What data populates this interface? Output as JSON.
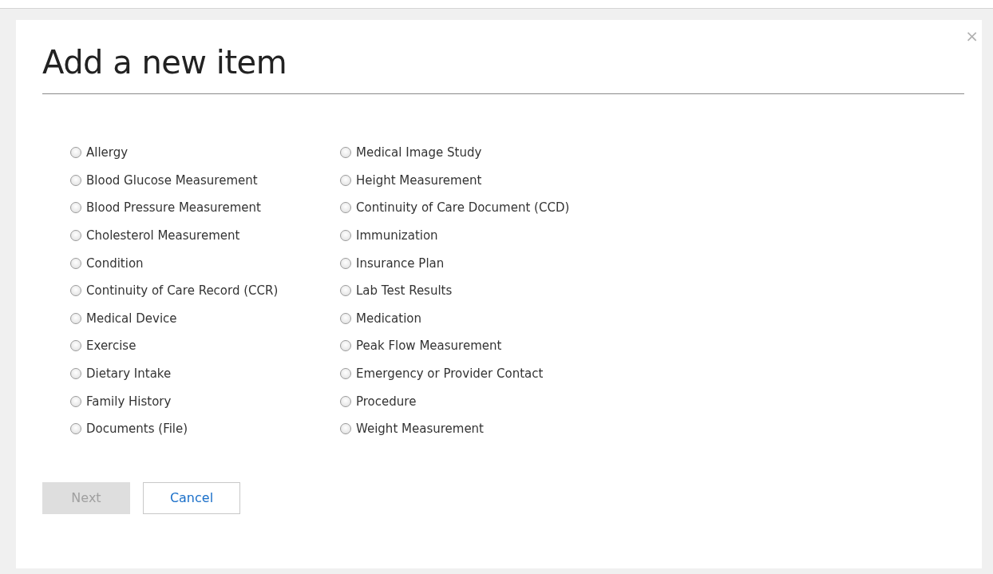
{
  "dialog": {
    "title": "Add a new item",
    "close": "×",
    "options": [
      {
        "label": "Allergy",
        "selected": false
      },
      {
        "label": "Blood Glucose Measurement",
        "selected": false
      },
      {
        "label": "Blood Pressure Measurement",
        "selected": false
      },
      {
        "label": "Cholesterol Measurement",
        "selected": false
      },
      {
        "label": "Condition",
        "selected": false
      },
      {
        "label": "Continuity of Care Record (CCR)",
        "selected": false
      },
      {
        "label": "Medical Device",
        "selected": false
      },
      {
        "label": "Exercise",
        "selected": false
      },
      {
        "label": "Dietary Intake",
        "selected": false
      },
      {
        "label": "Family History",
        "selected": false
      },
      {
        "label": "Documents (File)",
        "selected": false
      },
      {
        "label": "Medical Image Study",
        "selected": false
      },
      {
        "label": "Height Measurement",
        "selected": false
      },
      {
        "label": "Continuity of Care Document (CCD)",
        "selected": false
      },
      {
        "label": "Immunization",
        "selected": false
      },
      {
        "label": "Insurance Plan",
        "selected": false
      },
      {
        "label": "Lab Test Results",
        "selected": false
      },
      {
        "label": "Medication",
        "selected": false
      },
      {
        "label": "Peak Flow Measurement",
        "selected": false
      },
      {
        "label": "Emergency or Provider Contact",
        "selected": false
      },
      {
        "label": "Procedure",
        "selected": false
      },
      {
        "label": "Weight Measurement",
        "selected": false
      }
    ],
    "buttons": [
      {
        "label": "Next",
        "kind": "primary",
        "disabled": true
      },
      {
        "label": "Cancel",
        "kind": "secondary",
        "disabled": false
      }
    ]
  }
}
